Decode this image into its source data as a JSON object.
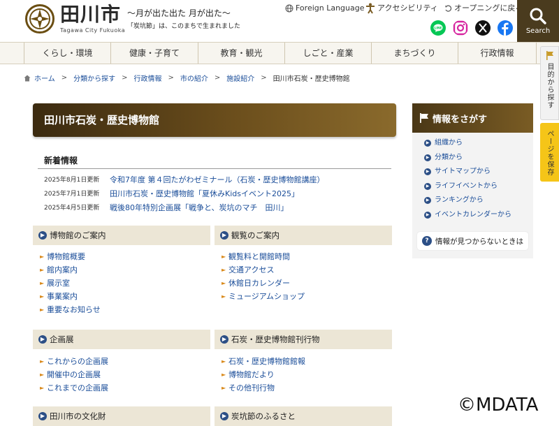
{
  "header": {
    "logo_name": "田川市",
    "logo_sub": "Tagawa City Fukuoka",
    "catch_main": "〜月が出た出た 月が出た〜",
    "catch_sub": "「炭坑節」は、このまちで生まれました",
    "util_links": [
      {
        "label": "Foreign Language",
        "icon": "globe-icon"
      },
      {
        "label": "アクセシビリティ",
        "icon": "accessibility-icon"
      },
      {
        "label": "オープニングに戻る",
        "icon": "back-arrow-icon"
      }
    ],
    "sns": [
      {
        "name": "LINE",
        "icon": "line-icon",
        "color": "#06c755"
      },
      {
        "name": "Instagram",
        "icon": "instagram-icon",
        "color": "#d6249f"
      },
      {
        "name": "X",
        "icon": "x-icon",
        "color": "#111111"
      },
      {
        "name": "Facebook",
        "icon": "facebook-icon",
        "color": "#1877f2"
      }
    ],
    "search_label": "Search"
  },
  "gnav": [
    "くらし・環境",
    "健康・子育て",
    "教育・観光",
    "しごと・産業",
    "まちづくり",
    "行政情報"
  ],
  "side_tabs": {
    "purpose": "目的から探す",
    "save": "ページを保存"
  },
  "breadcrumb": [
    "ホーム",
    "分類から探す",
    "行政情報",
    "市の紹介",
    "施設紹介",
    "田川市石炭・歴史博物館"
  ],
  "page_title": "田川市石炭・歴史博物館",
  "news": {
    "title": "新着情報",
    "items": [
      {
        "date": "2025年8月1日更新",
        "text": "令和7年度 第４回たがわゼミナール（石炭・歴史博物館講座）"
      },
      {
        "date": "2025年7月1日更新",
        "text": "田川市石炭・歴史博物館「夏休みKidsイベント2025」"
      },
      {
        "date": "2025年4月5日更新",
        "text": "戦後80年特別企画展「戦争と、炭坑のマチ　田川」"
      }
    ]
  },
  "boxes": [
    {
      "title": "博物館のご案内",
      "items": [
        "博物館概要",
        "館内案内",
        "展示室",
        "事業案内",
        "重要なお知らせ"
      ]
    },
    {
      "title": "観覧のご案内",
      "items": [
        "観覧料と開館時間",
        "交通アクセス",
        "休館日カレンダー",
        "ミュージアムショップ"
      ]
    },
    {
      "title": "企画展",
      "items": [
        "これからの企画展",
        "開催中の企画展",
        "これまでの企画展"
      ]
    },
    {
      "title": "石炭・歴史博物館刊行物",
      "items": [
        "石炭・歴史博物館館報",
        "博物館だより",
        "その他刊行物"
      ]
    },
    {
      "title": "田川市の文化財",
      "items": []
    },
    {
      "title": "炭坑節のふるさと",
      "items": []
    }
  ],
  "right_panel": {
    "title": "情報をさがす",
    "items": [
      "組織から",
      "分類から",
      "サイトマップから",
      "ライフイベントから",
      "ランキングから",
      "イベントカレンダーから"
    ],
    "help": "情報が見つからないときは"
  },
  "watermark": "©MDATA"
}
